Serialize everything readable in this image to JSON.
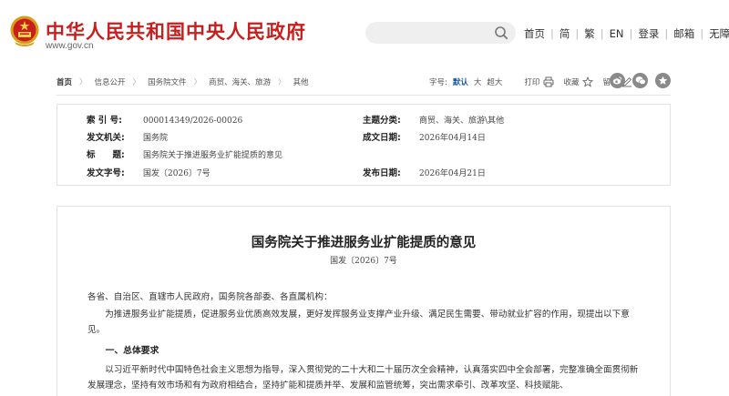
{
  "header": {
    "site_title": "中华人民共和国中央人民政府",
    "site_url": "www.gov.cn",
    "search": {
      "placeholder": ""
    },
    "nav": [
      {
        "label": "首页"
      },
      {
        "label": "简"
      },
      {
        "label": "繁"
      },
      {
        "label": "EN"
      },
      {
        "label": "登录"
      },
      {
        "label": "邮箱"
      },
      {
        "label": "无障碍"
      }
    ]
  },
  "breadcrumb": {
    "items": [
      "首页",
      "信息公开",
      "国务院文件",
      "商贸、海关、旅游",
      "其他"
    ],
    "separator": "〉"
  },
  "tools": {
    "font_size_label": "字号:",
    "size_default": "默认",
    "size_large": "大",
    "size_xlarge": "超大",
    "print_label": "打印",
    "favorite_label": "收藏",
    "comment_label": "留言"
  },
  "share": [
    "weibo-share",
    "wechat-share",
    "qzone-share"
  ],
  "metadata": {
    "index_label": "索 引 号:",
    "index_value": "000014349/2026-00026",
    "topic_label": "主题分类:",
    "topic_value": "商贸、海关、旅游\\其他",
    "issuer_label": "发文机关:",
    "issuer_value": "国务院",
    "written_label": "成文日期:",
    "written_value": "2026年04月14日",
    "title_label": "标　　题:",
    "title_value": "国务院关于推进服务业扩能提质的意见",
    "docno_label": "发文字号:",
    "docno_value": "国发〔2026〕7号",
    "published_label": "发布日期:",
    "published_value": "2026年04月21日"
  },
  "article": {
    "title": "国务院关于推进服务业扩能提质的意见",
    "doc_number": "国发〔2026〕7号",
    "salutation": "各省、自治区、直辖市人民政府，国务院各部委、各直属机构：",
    "para1": "为推进服务业扩能提质，促进服务业优质高效发展，更好发挥服务业支撑产业升级、满足民生需要、带动就业扩容的作用，现提出以下意见。",
    "section1": "一、总体要求",
    "para2": "以习近平新时代中国特色社会主义思想为指导，深入贯彻党的二十大和二十届历次全会精神，认真落实四中全会部署，完整准确全面贯彻新发展理念，坚持有效市场和有为政府相结合，坚持扩能和提质并举、发展和监管统筹，突出需求牵引、改革攻坚、科技赋能、"
  },
  "colors": {
    "brand_red": "#c81e1e",
    "link_blue": "#1a5ea8"
  }
}
